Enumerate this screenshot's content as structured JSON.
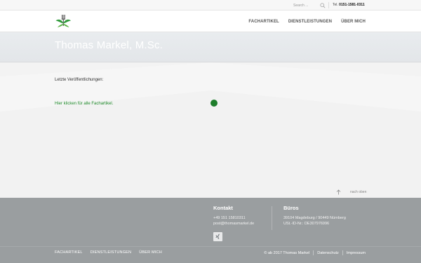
{
  "topbar": {
    "search_placeholder": "Search ...",
    "phone_prefix": "Tel.",
    "phone_number": "0151-1581-0311"
  },
  "header": {
    "nav": [
      {
        "label": "FACHARTIKEL"
      },
      {
        "label": "DIENSTLEISTUNGEN"
      },
      {
        "label": "ÜBER MICH"
      }
    ]
  },
  "banner": {
    "title": "Thomas Markel, M.Sc."
  },
  "main": {
    "intro": "Letzte Veröffentlichungen:",
    "link": "Hier klicken für alle Fachartikel."
  },
  "totop": {
    "label": "nach oben"
  },
  "footer": {
    "kontakt": {
      "heading": "Kontakt",
      "phone": "+49 151 15810311",
      "email": "post@thomasmarkel.de"
    },
    "bueros": {
      "heading": "Büros",
      "locations": "39104 Magdeburg / 90449 Nürnberg",
      "ust": "USt.-ID-Nr.: DE307976996"
    },
    "nav": [
      {
        "label": "FACHARTIKEL"
      },
      {
        "label": "DIENSTLEISTUNGEN"
      },
      {
        "label": "ÜBER MICH"
      }
    ],
    "copyright": "© ab 2017 Thomas Markel",
    "datenschutz": "Datenschutz",
    "impressum": "Impressum"
  },
  "colors": {
    "accent_green": "#1e7d2b",
    "footer_bg": "#9a9ea0"
  },
  "icons": {
    "logo": "leaf-fork-logo",
    "search": "search-icon",
    "totop": "arrow-up-icon",
    "social": "xing-icon"
  }
}
